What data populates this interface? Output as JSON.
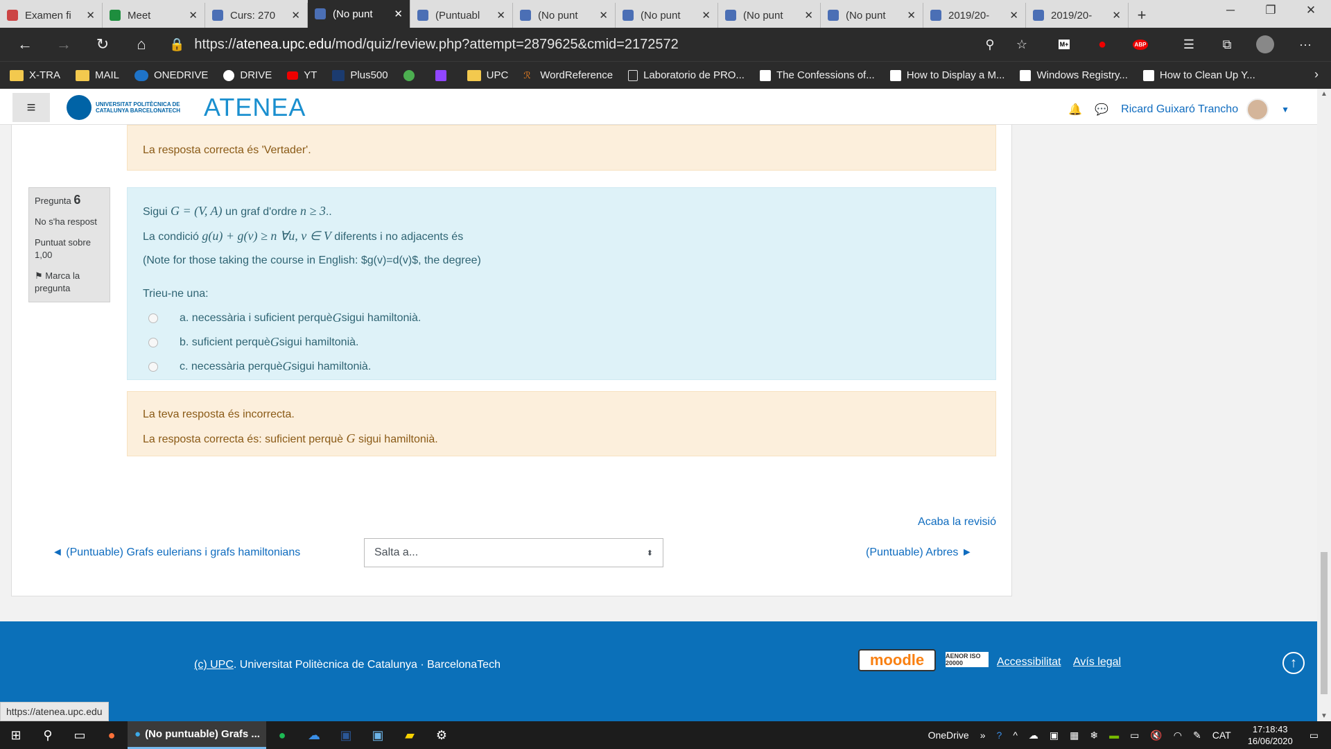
{
  "tabs": [
    {
      "title": "Examen fi",
      "active": false
    },
    {
      "title": "Meet",
      "active": false
    },
    {
      "title": "Curs: 270",
      "active": false
    },
    {
      "title": "(No punt",
      "active": true
    },
    {
      "title": "(Puntuabl",
      "active": false
    },
    {
      "title": "(No punt",
      "active": false
    },
    {
      "title": "(No punt",
      "active": false
    },
    {
      "title": "(No punt",
      "active": false
    },
    {
      "title": "(No punt",
      "active": false
    },
    {
      "title": "2019/20-",
      "active": false
    },
    {
      "title": "2019/20-",
      "active": false
    }
  ],
  "address": {
    "scheme": "https://",
    "host": "atenea.upc.edu",
    "path": "/mod/quiz/review.php?attempt=2879625&cmid=2172572"
  },
  "bookmarks": [
    "X-TRA",
    "MAIL",
    "ONEDRIVE",
    "DRIVE",
    "YT",
    "Plus500",
    "",
    "",
    "UPC",
    "WordReference",
    "Laboratorio de PRO...",
    "The Confessions of...",
    "How to Display a M...",
    "Windows Registry...",
    "How to Clean Up Y..."
  ],
  "navbar": {
    "logo_text": "UNIVERSITAT POLITÈCNICA DE CATALUNYA BARCELONATECH",
    "brand": "ATENEA",
    "user": "Ricard Guixaró Trancho"
  },
  "feedback_top": "La resposta correcta és 'Vertader'.",
  "question": {
    "label": "Pregunta",
    "number": "6",
    "state": "No s'ha respost",
    "mark": "Puntuat sobre 1,00",
    "flag": "Marca la pregunta",
    "text1_pre": "Sigui ",
    "text1_math": "G = (V, A)",
    "text1_mid": " un graf d'ordre ",
    "text1_math2": "n ≥ 3",
    "text1_post": "..",
    "text2_pre": "La condició ",
    "text2_math": "g(u) + g(v) ≥ n  ∀u, v ∈ V",
    "text2_post": " diferents i no adjacents  és",
    "text3": "(Note for those taking the course in English: $g(v)=d(v)$, the degree)",
    "prompt": "Trieu-ne una:",
    "options": [
      {
        "pre": "a. necessària i suficient perquè ",
        "math": "G",
        "post": " sigui hamiltonià."
      },
      {
        "pre": "b. suficient perquè ",
        "math": "G",
        "post": " sigui hamiltonià."
      },
      {
        "pre": "c. necessària perquè ",
        "math": "G",
        "post": " sigui hamiltonià."
      }
    ]
  },
  "feedback_bottom": {
    "line1": "La teva resposta és incorrecta.",
    "line2_pre": "La resposta correcta és: suficient perquè ",
    "line2_math": "G",
    "line2_post": " sigui hamiltonià."
  },
  "nav": {
    "end_review": "Acaba la revisió",
    "prev": "◄ (Puntuable) Grafs eulerians i grafs hamiltonians",
    "jump_placeholder": "Salta a...",
    "next": "(Puntuable) Arbres ►"
  },
  "footer": {
    "copy_link": "(c) UPC",
    "copy_text": ". Universitat Politècnica de Catalunya · BarcelonaTech",
    "moodle": "moodle",
    "aenor": "AENOR ISO 20000",
    "accessibility": "Accessibilitat",
    "legal": "Avís legal"
  },
  "status_url": "https://atenea.upc.edu",
  "taskbar": {
    "active_app": "(No puntuable) Grafs ...",
    "onedrive": "OneDrive",
    "lang": "CAT",
    "time": "17:18:43",
    "date": "16/06/2020"
  }
}
